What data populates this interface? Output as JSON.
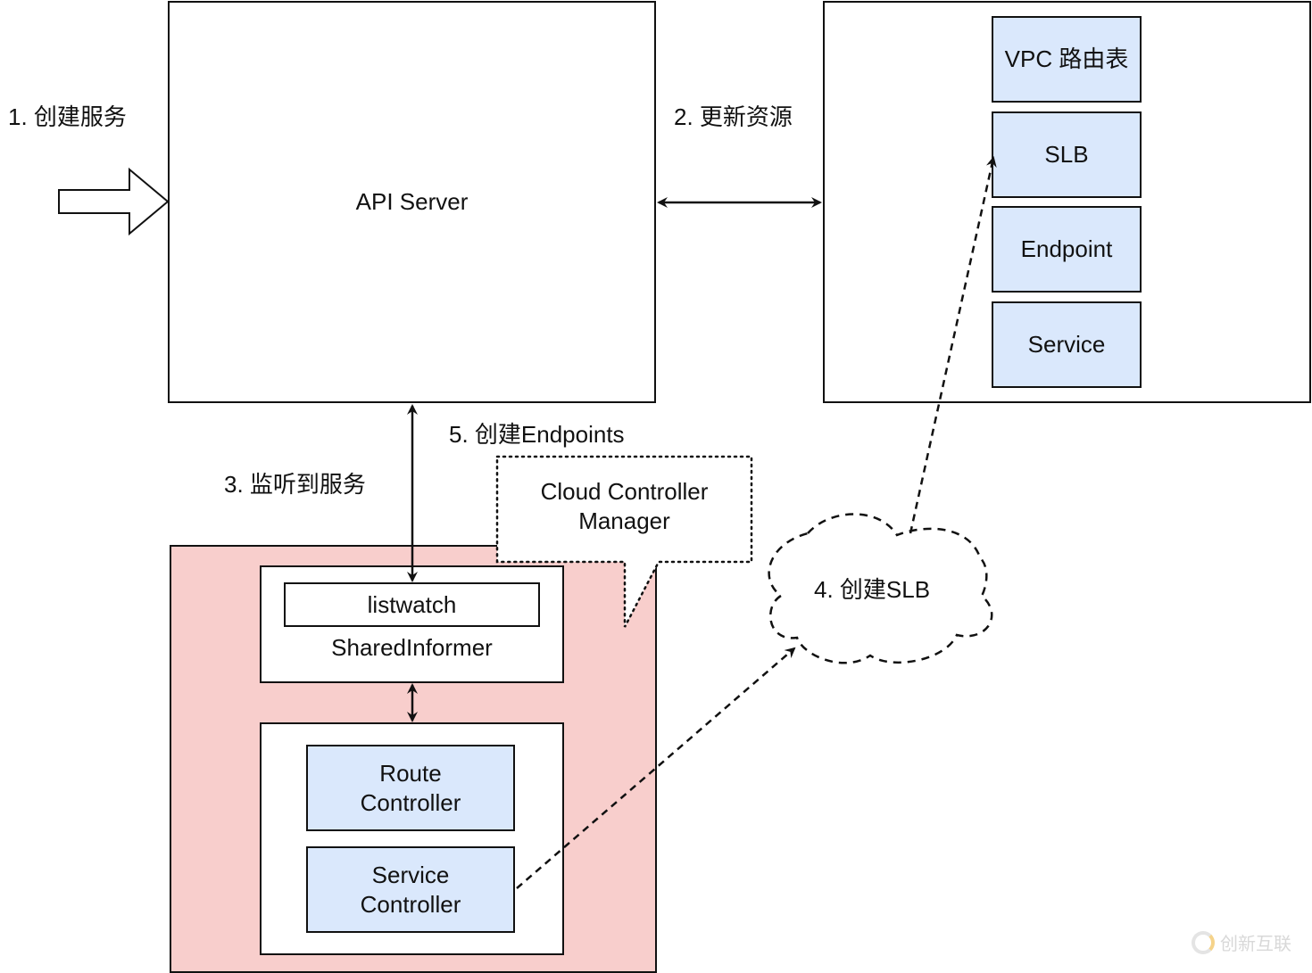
{
  "steps": {
    "step1": "1. 创建服务",
    "step2": "2. 更新资源",
    "step3": "3. 监听到服务",
    "step4": "4. 创建SLB",
    "step5": "5. 创建Endpoints"
  },
  "api_server": {
    "label": "API Server"
  },
  "cloud_resources": {
    "items": [
      "VPC 路由表",
      "SLB",
      "Endpoint",
      "Service"
    ],
    "fill_color": "#dae8fc"
  },
  "ccm": {
    "callout": "Cloud Controller Manager",
    "callout_line1": "Cloud Controller",
    "callout_line2": "Manager",
    "container_color": "#f8cecc",
    "shared_informer": {
      "label": "SharedInformer",
      "listwatch": "listwatch"
    },
    "controllers": [
      {
        "line1": "Route",
        "line2": "Controller"
      },
      {
        "line1": "Service",
        "line2": "Controller"
      }
    ]
  },
  "watermark": {
    "text": "创新互联"
  }
}
